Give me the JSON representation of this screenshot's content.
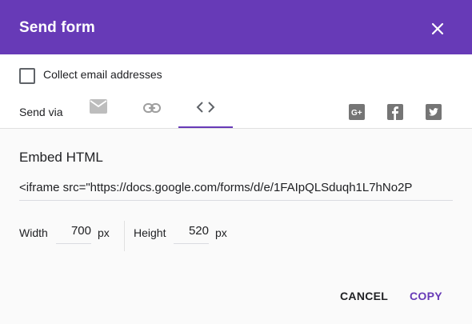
{
  "header": {
    "title": "Send form",
    "close_icon": "close-icon"
  },
  "options": {
    "collect_email_label": "Collect email addresses",
    "collect_email_checked": false
  },
  "send_via": {
    "label": "Send via",
    "tabs": [
      {
        "name": "email",
        "icon": "mail-icon",
        "active": false
      },
      {
        "name": "link",
        "icon": "link-icon",
        "active": false
      },
      {
        "name": "embed",
        "icon": "code-icon",
        "active": true
      }
    ],
    "share": [
      {
        "name": "google-plus",
        "icon": "google-plus-icon"
      },
      {
        "name": "facebook",
        "icon": "facebook-icon"
      },
      {
        "name": "twitter",
        "icon": "twitter-icon"
      }
    ]
  },
  "embed": {
    "title": "Embed HTML",
    "code": "<iframe src=\"https://docs.google.com/forms/d/e/1FAIpQLSduqh1L7hNo2P",
    "width_label": "Width",
    "width_value": "700",
    "height_label": "Height",
    "height_value": "520",
    "unit": "px"
  },
  "actions": {
    "cancel_label": "CANCEL",
    "copy_label": "COPY"
  },
  "colors": {
    "accent": "#673ab7",
    "icon_gray": "#9e9e9e",
    "social_gray": "#757575"
  }
}
